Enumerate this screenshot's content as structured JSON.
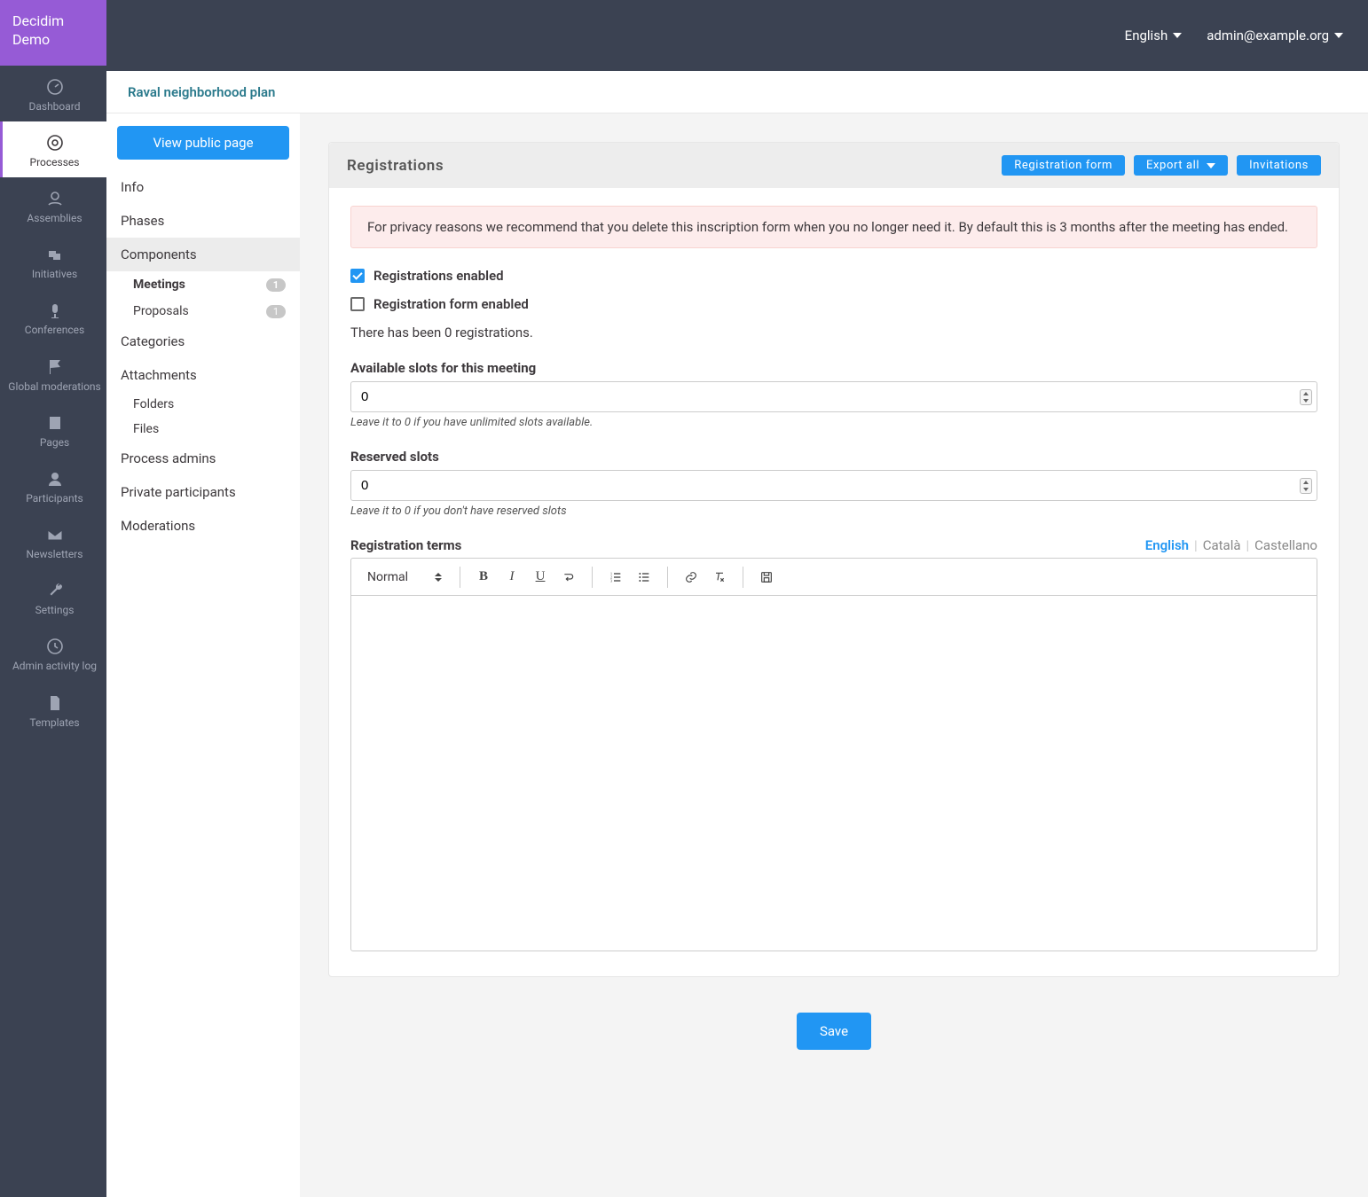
{
  "brand": "Decidim Demo",
  "topbar": {
    "language": "English",
    "user": "admin@example.org"
  },
  "page_title": "Raval neighborhood plan",
  "main_nav": [
    {
      "label": "Dashboard"
    },
    {
      "label": "Processes"
    },
    {
      "label": "Assemblies"
    },
    {
      "label": "Initiatives"
    },
    {
      "label": "Conferences"
    },
    {
      "label": "Global moderations"
    },
    {
      "label": "Pages"
    },
    {
      "label": "Participants"
    },
    {
      "label": "Newsletters"
    },
    {
      "label": "Settings"
    },
    {
      "label": "Admin activity log"
    },
    {
      "label": "Templates"
    }
  ],
  "secondary": {
    "view_public": "View public page",
    "info": "Info",
    "phases": "Phases",
    "components": "Components",
    "meetings": "Meetings",
    "meetings_badge": "1",
    "proposals": "Proposals",
    "proposals_badge": "1",
    "categories": "Categories",
    "attachments": "Attachments",
    "folders": "Folders",
    "files": "Files",
    "process_admins": "Process admins",
    "private_participants": "Private participants",
    "moderations": "Moderations"
  },
  "registrations": {
    "title": "Registrations",
    "btn_form": "Registration form",
    "btn_export": "Export all",
    "btn_invitations": "Invitations",
    "alert": "For privacy reasons we recommend that you delete this inscription form when you no longer need it. By default this is 3 months after the meeting has ended.",
    "enabled_label": "Registrations enabled",
    "form_enabled_label": "Registration form enabled",
    "count_text": "There has been 0 registrations.",
    "slots_label": "Available slots for this meeting",
    "slots_value": "0",
    "slots_help": "Leave it to 0 if you have unlimited slots available.",
    "reserved_label": "Reserved slots",
    "reserved_value": "0",
    "reserved_help": "Leave it to 0 if you don't have reserved slots",
    "terms_label": "Registration terms",
    "lang_en": "English",
    "lang_ca": "Català",
    "lang_es": "Castellano",
    "editor_format": "Normal",
    "save": "Save"
  }
}
